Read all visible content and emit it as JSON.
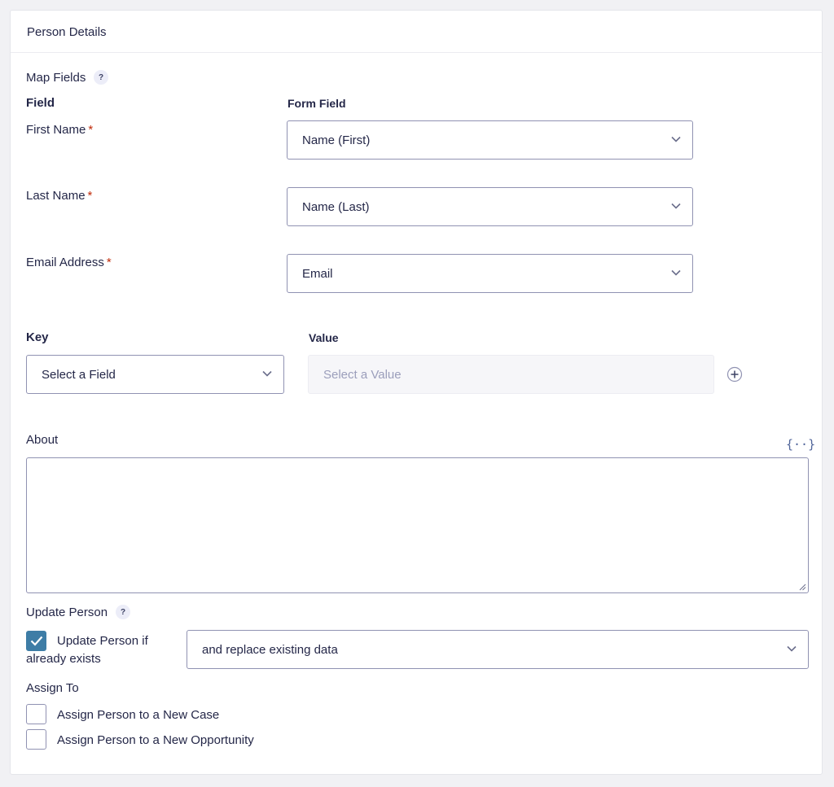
{
  "panel": {
    "title": "Person Details"
  },
  "map_fields": {
    "label": "Map Fields",
    "help": "?",
    "header_field": "Field",
    "header_form_field": "Form Field",
    "rows": [
      {
        "field": "First Name",
        "required": "*",
        "value": "Name (First)"
      },
      {
        "field": "Last Name",
        "required": "*",
        "value": "Name (Last)"
      },
      {
        "field": "Email Address",
        "required": "*",
        "value": "Email"
      }
    ]
  },
  "custom": {
    "header_key": "Key",
    "header_value": "Value",
    "key_select": "Select a Field",
    "value_placeholder": "Select a Value"
  },
  "about": {
    "label": "About",
    "merge_tag_icon": "{··}"
  },
  "update": {
    "label": "Update Person",
    "help": "?",
    "checkbox_label_line1": "Update Person if",
    "checkbox_label_line2": "already exists",
    "checked": true,
    "mode_select": "and replace existing data"
  },
  "assign": {
    "label": "Assign To",
    "options": [
      {
        "label": "Assign Person to a New Case",
        "checked": false
      },
      {
        "label": "Assign Person to a New Opportunity",
        "checked": false
      }
    ]
  },
  "colors": {
    "accent": "#3e7da6",
    "required": "#c02b0a",
    "border": "#9092b2"
  }
}
